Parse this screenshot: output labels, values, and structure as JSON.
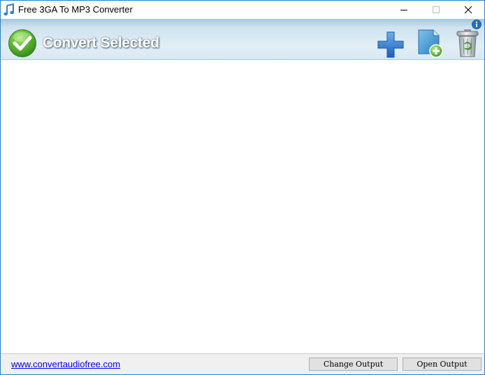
{
  "window": {
    "title": "Free 3GA To MP3 Converter"
  },
  "toolbar": {
    "convert_label": "Convert Selected",
    "icons": [
      "check-circle-icon",
      "add-plus-icon",
      "add-file-icon",
      "trash-icon",
      "info-icon"
    ]
  },
  "status": {
    "link_text": "www.convertaudiofree.com",
    "change_output_label": "Change Output",
    "open_output_label": "Open Output"
  },
  "colors": {
    "accent_blue": "#2b7ec7",
    "check_green": "#5cb832",
    "link_blue": "#0000ee"
  }
}
